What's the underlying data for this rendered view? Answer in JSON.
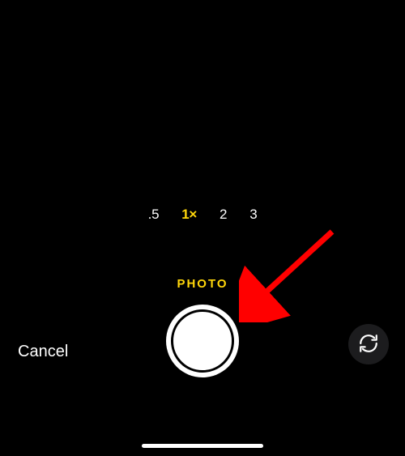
{
  "zoom": {
    "options": [
      ".5",
      "1×",
      "2",
      "3"
    ],
    "activeIndex": 1
  },
  "mode": {
    "label": "PHOTO"
  },
  "controls": {
    "cancelLabel": "Cancel"
  },
  "colors": {
    "accent": "#FFD60A",
    "annotationArrow": "#FF0000"
  }
}
